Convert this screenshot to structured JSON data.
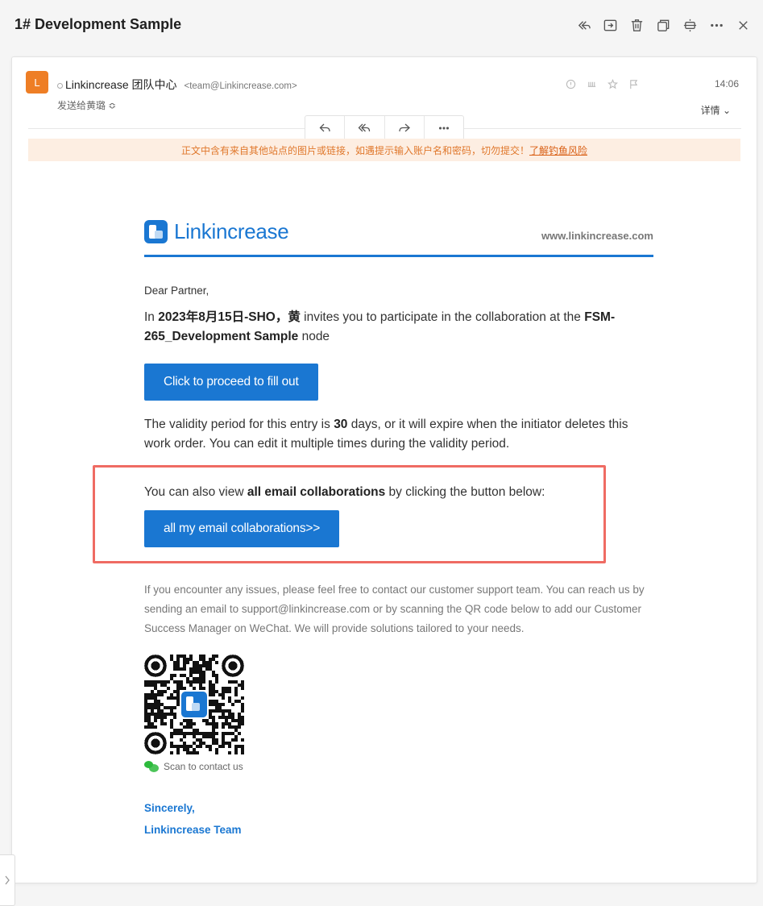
{
  "header": {
    "subject": "1# Development Sample",
    "icons": [
      "reply-all-icon",
      "move-to-folder-icon",
      "trash-icon",
      "new-window-icon",
      "split-view-icon",
      "more-icon",
      "close-icon"
    ]
  },
  "message": {
    "avatar_letter": "L",
    "sender_name": "Linkincrease 团队中心",
    "sender_email": "<team@Linkincrease.com>",
    "recipient": "发送给黄璐 ≎",
    "time": "14:06",
    "details_label": "详情 ⌄",
    "meta_icons": [
      "priority-icon",
      "read-receipt-icon",
      "star-icon",
      "flag-icon"
    ],
    "actions": [
      "reply-icon",
      "reply-all-icon",
      "forward-icon",
      "more-icon"
    ]
  },
  "warning": {
    "text": "正文中含有来自其他站点的图片或链接，如遇提示输入账户名和密码，切勿提交！",
    "link": "了解钓鱼风险"
  },
  "email": {
    "brand_name": "Linkincrease",
    "website": "www.linkincrease.com",
    "greeting": "Dear Partner,",
    "invite_prefix": "In ",
    "invite_bold1": "2023年8月15日-SHO，黄",
    "invite_mid": " invites you to participate in the collaboration at the ",
    "invite_bold2": "FSM-265_Development Sample",
    "invite_suffix": " node",
    "fill_button": "Click to proceed to fill out",
    "validity_prefix": "The validity period for this entry is ",
    "validity_days": "30",
    "validity_suffix": " days, or it will expire when the initiator deletes this work order. You can edit it multiple times during the validity period.",
    "also_prefix": "You can also view ",
    "also_bold": "all email collaborations",
    "also_suffix": " by clicking the button below:",
    "collab_button": "all my email collaborations>>",
    "support": "If you encounter any issues, please feel free to contact our customer support team. You can reach us by sending an email to support@linkincrease.com or by scanning the QR code below to add our Customer Success Manager on WeChat. We will provide solutions tailored to your needs.",
    "scan_label": "Scan to contact us",
    "sign_line1": "Sincerely,",
    "sign_line2": "Linkincrease Team"
  },
  "colors": {
    "brand": "#1a77d2",
    "warning_bg": "#fdeee2",
    "warning_text": "#e0782c",
    "highlight": "#ef6b63",
    "avatar": "#ee7e25"
  }
}
